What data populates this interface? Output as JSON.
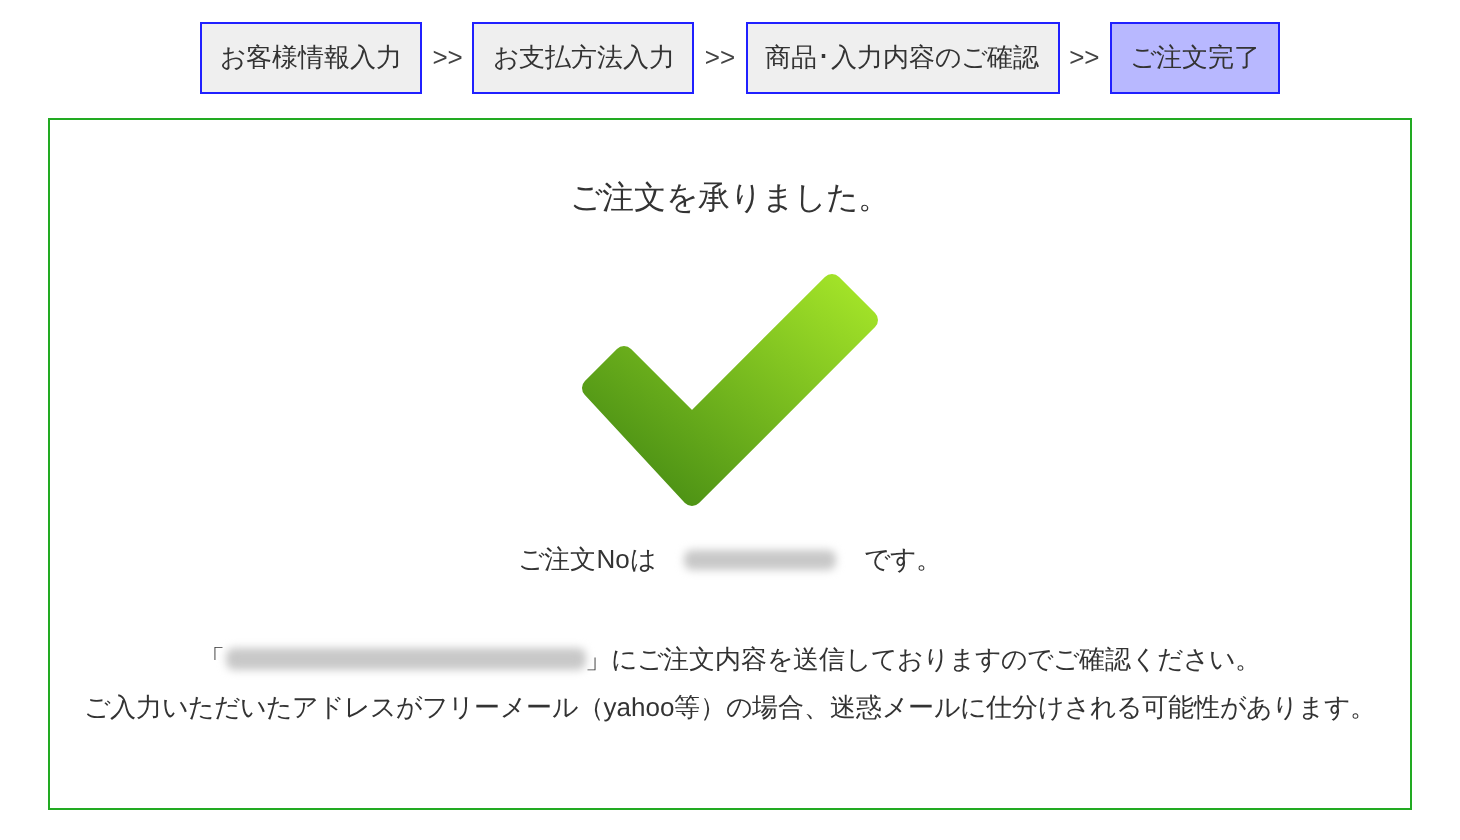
{
  "steps": [
    {
      "label": "お客様情報入力",
      "selected": false
    },
    {
      "label": "お支払方法入力",
      "selected": false
    },
    {
      "label": "商品･入力内容のご確認",
      "selected": false
    },
    {
      "label": "ご注文完了",
      "selected": true
    }
  ],
  "separator": ">>",
  "panel": {
    "heading": "ご注文を承りました。",
    "order_prefix": "ご注文Noは",
    "order_suffix": "です。",
    "mail_open": "「",
    "mail_close": "」にご注文内容を送信しておりますのでご確認ください。",
    "notice": "ご入力いただいたアドレスがフリーメール（yahoo等）の場合、迷惑メールに仕分けされる可能性があります。"
  }
}
